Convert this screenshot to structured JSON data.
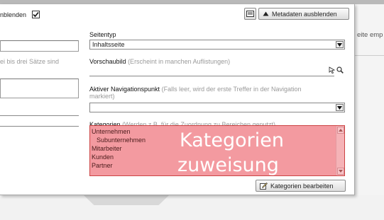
{
  "left_col": {
    "checkbox_label_fragment": "nblenden",
    "hint_fragment": "ei bis drei Sätze sind"
  },
  "toolbar": {
    "hide_metadata_label": "Metadaten ausblenden"
  },
  "seitentyp": {
    "label": "Seitentyp",
    "value": "Inhaltsseite"
  },
  "vorschaubild": {
    "label": "Vorschaubild",
    "hint": "(Erscheint in manchen Auflistungen)"
  },
  "navpunkt": {
    "label": "Aktiver Navigationspunkt",
    "hint_line1": "(Falls leer, wird der erste Treffer in der Navigation",
    "hint_line2": "markiert)"
  },
  "kategorien": {
    "label": "Kategorien",
    "hint": "(Werden z.B. für die Zuordnung zu Bereichen genutzt)",
    "items": [
      "Unternehmen",
      "Subunternehmen",
      "Mitarbeiter",
      "Kunden",
      "Partner"
    ],
    "edit_button_label": "Kategorien bearbeiten"
  },
  "overlay": {
    "line1": "Kategorien",
    "line2": "zuweisung"
  },
  "background": {
    "right_fragment": "eite emp"
  },
  "colors": {
    "highlight": "#f39aa0",
    "overlay_text": "#ffffff"
  },
  "icons": {
    "checkbox": "checkmark-icon",
    "details": "list-icon",
    "collapse": "triangle-up-icon",
    "picker": "arrow-pointer-icon",
    "search": "magnifier-icon",
    "edit": "pencil-icon"
  }
}
